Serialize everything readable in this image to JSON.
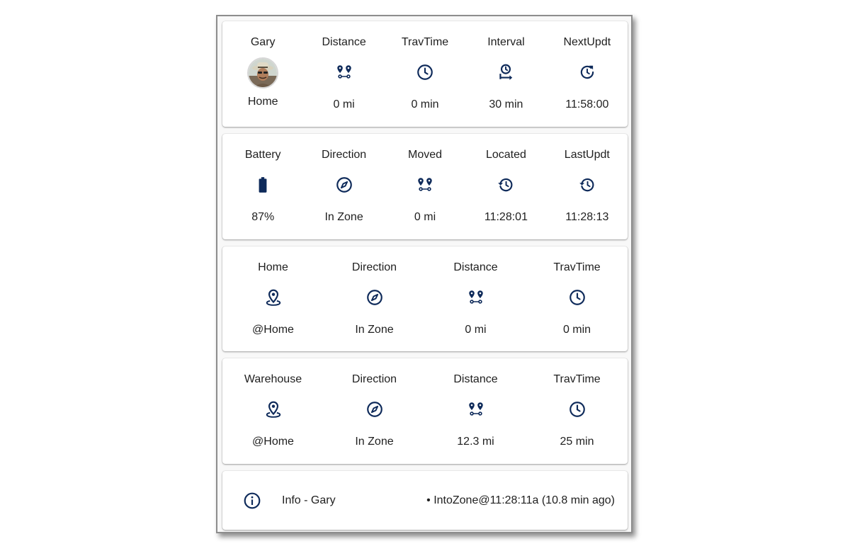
{
  "colors": {
    "icon": "#0e2a5a",
    "card_bg": "#ffffff",
    "frame_border": "#8d8d8d"
  },
  "cards": [
    {
      "items": [
        {
          "name": "Gary",
          "icon": "avatar",
          "state": "Home"
        },
        {
          "name": "Distance",
          "icon": "map-marker-distance",
          "state": "0 mi"
        },
        {
          "name": "TravTime",
          "icon": "clock",
          "state": "0 min"
        },
        {
          "name": "Interval",
          "icon": "timer-arrow",
          "state": "30 min"
        },
        {
          "name": "NextUpdt",
          "icon": "clock-refresh",
          "state": "11:58:00"
        }
      ]
    },
    {
      "items": [
        {
          "name": "Battery",
          "icon": "battery",
          "state": "87%"
        },
        {
          "name": "Direction",
          "icon": "compass",
          "state": "In Zone"
        },
        {
          "name": "Moved",
          "icon": "map-marker-distance",
          "state": "0 mi"
        },
        {
          "name": "Located",
          "icon": "history",
          "state": "11:28:01"
        },
        {
          "name": "LastUpdt",
          "icon": "history",
          "state": "11:28:13"
        }
      ]
    },
    {
      "items": [
        {
          "name": "Home",
          "icon": "map-marker-radius",
          "state": "@Home"
        },
        {
          "name": "Direction",
          "icon": "compass",
          "state": "In Zone"
        },
        {
          "name": "Distance",
          "icon": "map-marker-distance",
          "state": "0 mi"
        },
        {
          "name": "TravTime",
          "icon": "clock",
          "state": "0 min"
        }
      ]
    },
    {
      "items": [
        {
          "name": "Warehouse",
          "icon": "map-marker-radius",
          "state": "@Home"
        },
        {
          "name": "Direction",
          "icon": "compass",
          "state": "In Zone"
        },
        {
          "name": "Distance",
          "icon": "map-marker-distance",
          "state": "12.3 mi"
        },
        {
          "name": "TravTime",
          "icon": "clock",
          "state": "25 min"
        }
      ]
    }
  ],
  "info": {
    "icon": "information-outline",
    "name": "Info - Gary",
    "state": "• IntoZone@11:28:11a (10.8 min ago)"
  }
}
